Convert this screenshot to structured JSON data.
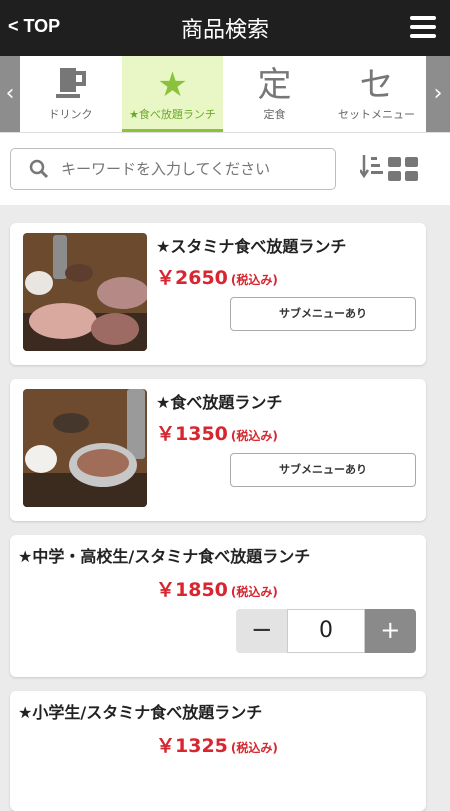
{
  "header": {
    "back_label": "< TOP",
    "title": "商品検索"
  },
  "tabs": [
    {
      "glyph": "",
      "label": "ドリンク"
    },
    {
      "glyph": "★",
      "label": "★食べ放題ランチ"
    },
    {
      "glyph": "定",
      "label": "定食"
    },
    {
      "glyph": "セ",
      "label": "セットメニュー"
    }
  ],
  "arrows": {
    "left": "‹",
    "right": "›"
  },
  "search": {
    "placeholder": "キーワードを入力してください"
  },
  "items": [
    {
      "name": "★スタミナ食べ放題ランチ",
      "price": "￥2650",
      "tax": "(税込み)",
      "submenu": "サブメニューあり"
    },
    {
      "name": "★食べ放題ランチ",
      "price": "￥1350",
      "tax": "(税込み)",
      "submenu": "サブメニューあり"
    },
    {
      "name": "★中学・高校生/スタミナ食べ放題ランチ",
      "price": "￥1850",
      "tax": "(税込み)",
      "qty": "0",
      "minus": "−",
      "plus": "+"
    },
    {
      "name": "★小学生/スタミナ食べ放題ランチ",
      "price": "￥1325",
      "tax": "(税込み)"
    }
  ],
  "colors": {
    "accent": "#8bc23d",
    "price": "#d7262f",
    "header": "#1f1f1f"
  }
}
